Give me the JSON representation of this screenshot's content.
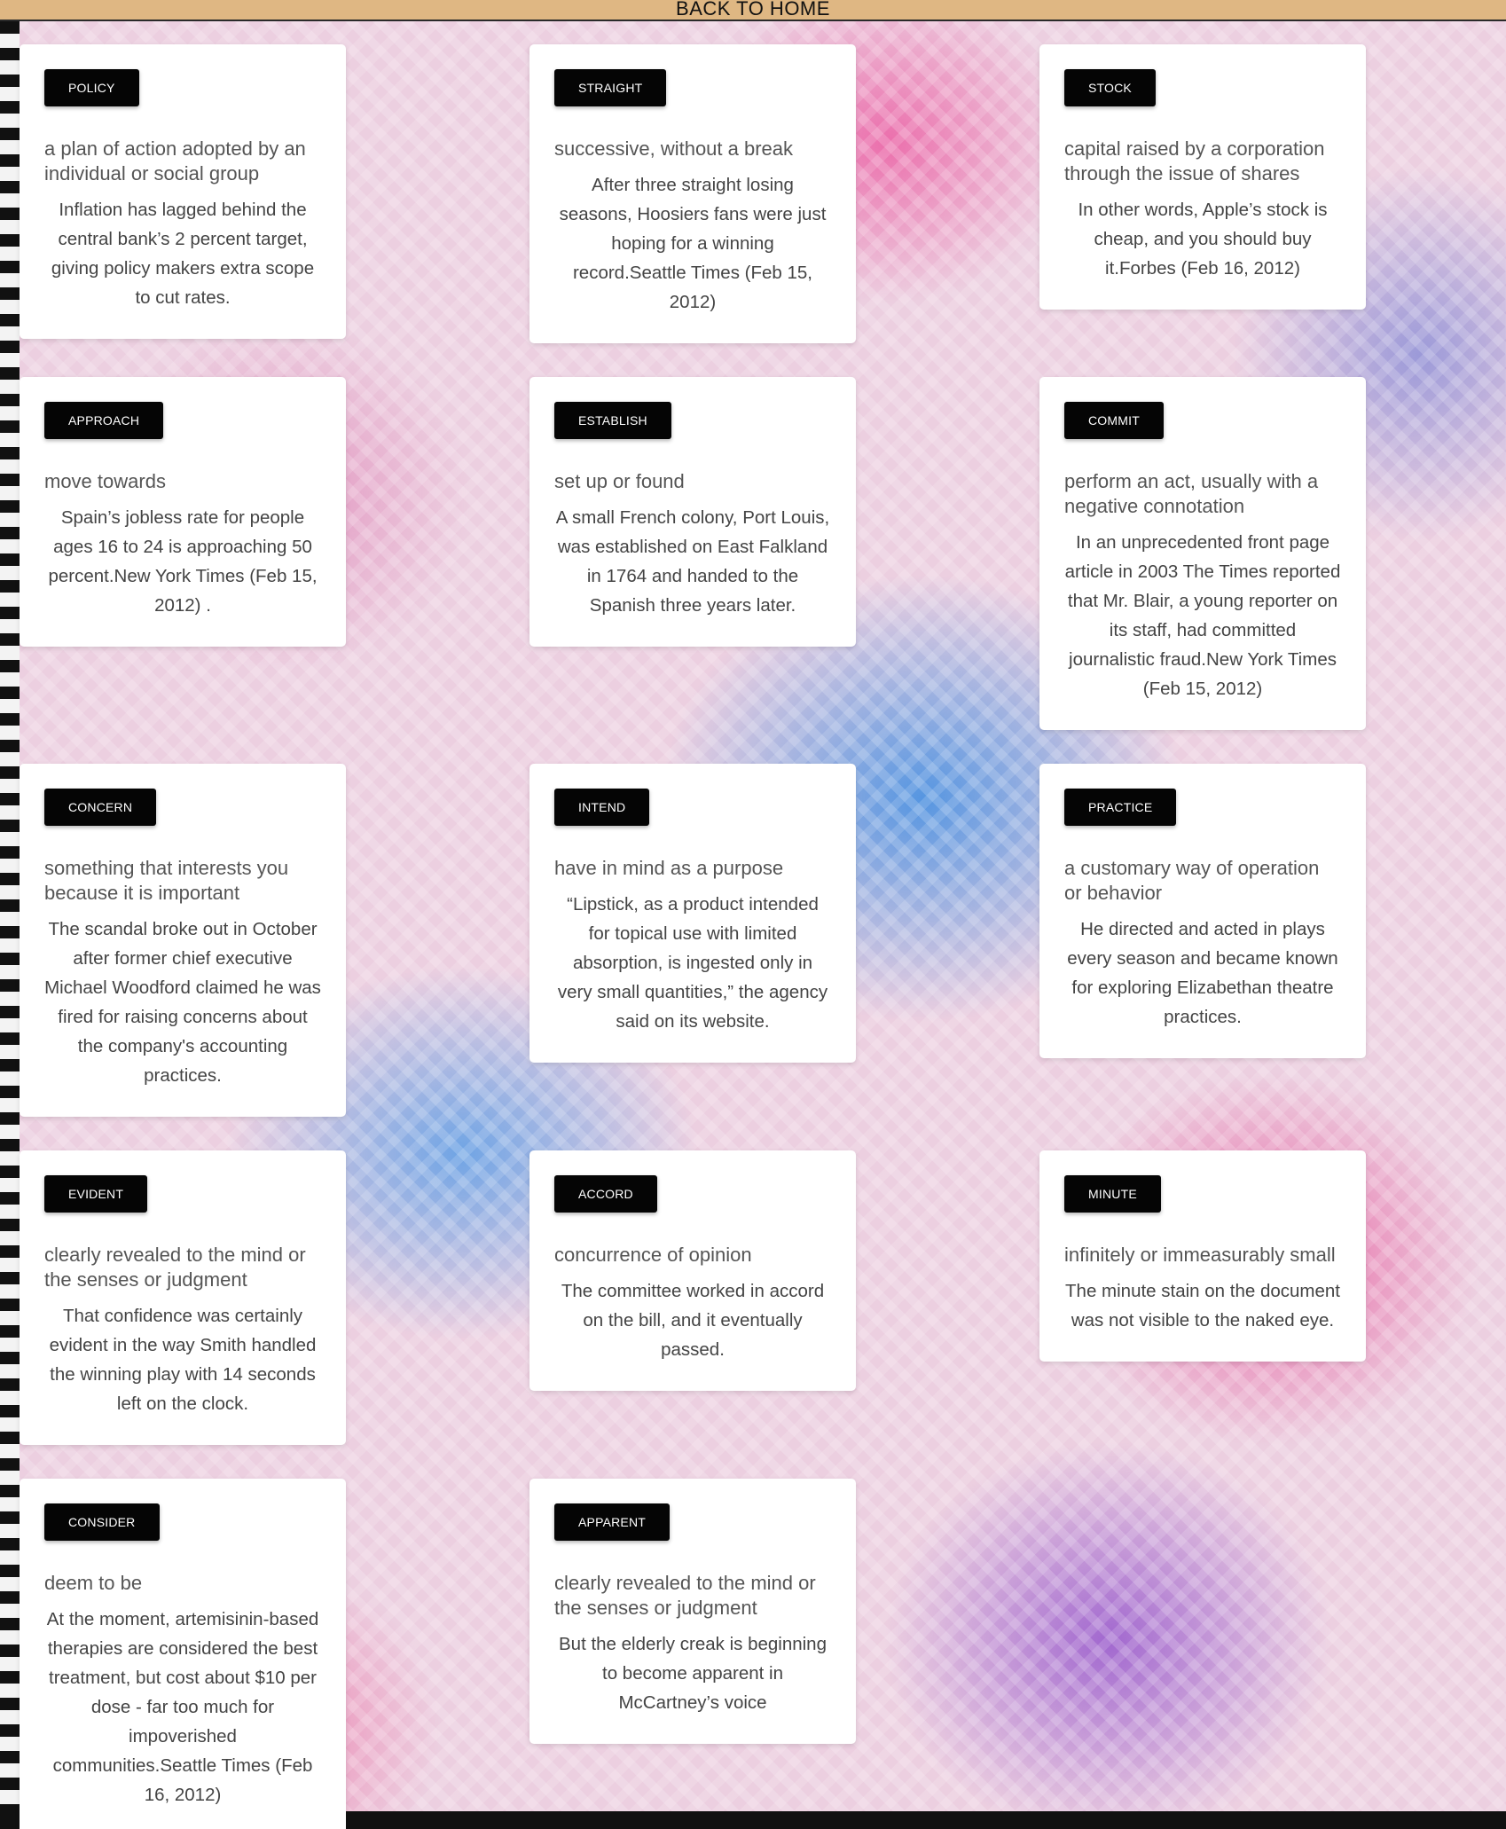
{
  "nav": {
    "back_label": "BACK TO HOME"
  },
  "cards": [
    {
      "word": "POLICY",
      "definition": "a plan of action adopted by an individual or social group",
      "example": "Inflation has lagged behind the central bank’s 2 percent target, giving policy makers extra scope to cut rates."
    },
    {
      "word": "STRAIGHT",
      "definition": "successive, without a break",
      "example": "After three straight losing seasons, Hoosiers fans were just hoping for a winning record.Seattle Times (Feb 15, 2012)"
    },
    {
      "word": "STOCK",
      "definition": "capital raised by a corporation through the issue of shares",
      "example": "In other words, Apple’s stock is cheap, and you should buy it.Forbes (Feb 16, 2012)"
    },
    {
      "word": "APPROACH",
      "definition": "move towards",
      "example": "Spain’s jobless rate for people ages 16 to 24 is approaching 50 percent.New York Times (Feb 15, 2012) ."
    },
    {
      "word": "ESTABLISH",
      "definition": "set up or found",
      "example": "A small French colony, Port Louis, was established on East Falkland in 1764 and handed to the Spanish three years later."
    },
    {
      "word": "COMMIT",
      "definition": "perform an act, usually with a negative connotation",
      "example": "In an unprecedented front page article in 2003 The Times reported that Mr. Blair, a young reporter on its staff, had committed journalistic fraud.New York Times (Feb 15, 2012)"
    },
    {
      "word": "CONCERN",
      "definition": "something that interests you because it is important",
      "example": "The scandal broke out in October after former chief executive Michael Woodford claimed he was fired for raising concerns about the company's accounting practices."
    },
    {
      "word": "INTEND",
      "definition": "have in mind as a purpose",
      "example": "“Lipstick, as a product intended for topical use with limited absorption, is ingested only in very small quantities,” the agency said on its website."
    },
    {
      "word": "PRACTICE",
      "definition": "a customary way of operation or behavior",
      "example": "He directed and acted in plays every season and became known for exploring Elizabethan theatre practices."
    },
    {
      "word": "EVIDENT",
      "definition": "clearly revealed to the mind or the senses or judgment",
      "example": "That confidence was certainly evident in the way Smith handled the winning play with 14 seconds left on the clock."
    },
    {
      "word": "ACCORD",
      "definition": "concurrence of opinion",
      "example": "The committee worked in accord on the bill, and it eventually passed."
    },
    {
      "word": "MINUTE",
      "definition": "infinitely or immeasurably small",
      "example": "The minute stain on the document was not visible to the naked eye."
    },
    {
      "word": "CONSIDER",
      "definition": "deem to be",
      "example": "At the moment, artemisinin-based therapies are considered the best treatment, but cost about $10 per dose - far too much for impoverished communities.Seattle Times (Feb 16, 2012)"
    },
    {
      "word": "APPARENT",
      "definition": "clearly revealed to the mind or the senses or judgment",
      "example": "But the elderly creak is beginning to become apparent in McCartney’s voice"
    }
  ]
}
